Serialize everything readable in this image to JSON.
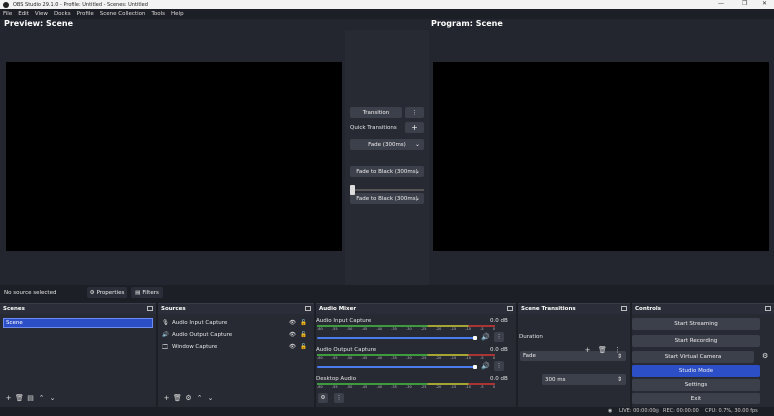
{
  "window": {
    "title": "OBS Studio 29.1.0 - Profile: Untitled - Scenes: Untitled",
    "minimize": "—",
    "maximize": "❐",
    "close": "✕"
  },
  "menu": [
    "File",
    "Edit",
    "View",
    "Docks",
    "Profile",
    "Scene Collection",
    "Tools",
    "Help"
  ],
  "preview": {
    "label": "Preview: Scene"
  },
  "program": {
    "label": "Program: Scene"
  },
  "studio": {
    "transition_label": "Transition",
    "more": "⋮",
    "quick_transitions": "Quick Transitions",
    "add": "+",
    "fades": [
      "Fade (300ms)",
      "Fade to Black (300ms)",
      "Fade to Black (300ms)"
    ]
  },
  "context": {
    "no_source": "No source selected",
    "properties": "Properties",
    "filters": "Filters"
  },
  "scenes": {
    "title": "Scenes",
    "items": [
      "Scene"
    ]
  },
  "sources": {
    "title": "Sources",
    "items": [
      "Audio Input Capture",
      "Audio Output Capture",
      "Window Capture"
    ]
  },
  "mixer": {
    "title": "Audio Mixer",
    "ticks": [
      "-60",
      "-55",
      "-50",
      "-45",
      "-40",
      "-35",
      "-30",
      "-25",
      "-20",
      "-15",
      "-10",
      "-5",
      "0"
    ],
    "channels": [
      {
        "name": "Audio Input Capture",
        "db": "0.0 dB"
      },
      {
        "name": "Audio Output Capture",
        "db": "0.0 dB"
      },
      {
        "name": "Desktop Audio",
        "db": "0.0 dB"
      }
    ]
  },
  "transitions": {
    "title": "Scene Transitions",
    "selected": "Fade",
    "duration_label": "Duration",
    "duration": "300 ms"
  },
  "controls": {
    "title": "Controls",
    "start_streaming": "Start Streaming",
    "start_recording": "Start Recording",
    "start_virtual": "Start Virtual Camera",
    "studio_mode": "Studio Mode",
    "settings": "Settings",
    "exit": "Exit"
  },
  "status": {
    "live": "LIVE: 00:00:00",
    "rec": "REC: 00:00:00",
    "cpu": "CPU: 0.7%, 30.00 fps"
  },
  "colors": {
    "accent": "#2c4fc7",
    "bg": "#1d1f26"
  }
}
